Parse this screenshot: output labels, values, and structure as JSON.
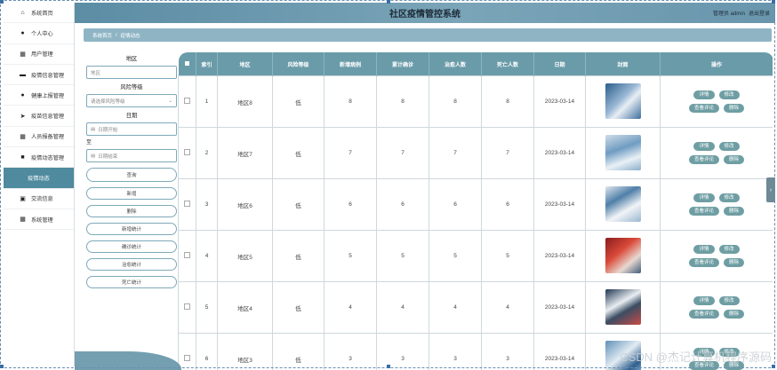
{
  "app": {
    "title": "社区疫情管控系统",
    "admin_label": "管理员 admin",
    "logout": "退出登录"
  },
  "sidebar": {
    "items": [
      {
        "label": "系统首页",
        "icon": "home-icon"
      },
      {
        "label": "个人中心",
        "icon": "user-icon"
      },
      {
        "label": "用户管理",
        "icon": "grid-icon"
      },
      {
        "label": "疫情信息管理",
        "icon": "monitor-icon"
      },
      {
        "label": "健康上报管理",
        "icon": "user-icon"
      },
      {
        "label": "疫苗信息管理",
        "icon": "send-icon"
      },
      {
        "label": "人员报备管理",
        "icon": "grid-icon"
      },
      {
        "label": "疫情动态管理",
        "icon": "video-icon"
      },
      {
        "label": "疫情动态",
        "icon": "",
        "active": true
      },
      {
        "label": "交流信息",
        "icon": "chat-icon"
      },
      {
        "label": "系统管理",
        "icon": "grid-icon"
      }
    ]
  },
  "breadcrumb": {
    "home": "系统首页",
    "sep": "/",
    "current": "疫情动态"
  },
  "search": {
    "region_label": "地区",
    "region_placeholder": "地区",
    "risk_label": "风险等级",
    "risk_placeholder": "请选择风险等级",
    "date_label": "日期",
    "date_start": "日期开始",
    "date_to": "至",
    "date_end": "日期结束",
    "query": "查询",
    "add": "新增",
    "delete": "删除",
    "stat_new": "新增统计",
    "stat_confirmed": "确诊统计",
    "stat_cured": "治愈统计",
    "stat_death": "死亡统计"
  },
  "table": {
    "headers": [
      "",
      "索引",
      "地区",
      "风险等级",
      "新增病例",
      "累计确诊",
      "治愈人数",
      "死亡人数",
      "日期",
      "封面",
      "操作"
    ],
    "ops": {
      "detail": "详情",
      "edit": "修改",
      "comments": "查看评论",
      "delete": "删除"
    },
    "rows": [
      {
        "idx": "1",
        "region": "地区8",
        "risk": "低",
        "new": "8",
        "total": "8",
        "cured": "8",
        "death": "8",
        "date": "2023-03-14"
      },
      {
        "idx": "2",
        "region": "地区7",
        "risk": "低",
        "new": "7",
        "total": "7",
        "cured": "7",
        "death": "7",
        "date": "2023-03-14"
      },
      {
        "idx": "3",
        "region": "地区6",
        "risk": "低",
        "new": "6",
        "total": "6",
        "cured": "6",
        "death": "6",
        "date": "2023-03-14"
      },
      {
        "idx": "4",
        "region": "地区5",
        "risk": "低",
        "new": "5",
        "total": "5",
        "cured": "5",
        "death": "5",
        "date": "2023-03-14"
      },
      {
        "idx": "5",
        "region": "地区4",
        "risk": "低",
        "new": "4",
        "total": "4",
        "cured": "4",
        "death": "4",
        "date": "2023-03-14"
      },
      {
        "idx": "6",
        "region": "地区3",
        "risk": "低",
        "new": "3",
        "total": "3",
        "cured": "3",
        "death": "3",
        "date": "2023-03-14"
      }
    ]
  },
  "watermark": "CSDN @杰记计算机程序源码",
  "colors": {
    "accent": "#4f8a9e",
    "header": "#6a9ba9",
    "button": "#6e9ea3"
  }
}
